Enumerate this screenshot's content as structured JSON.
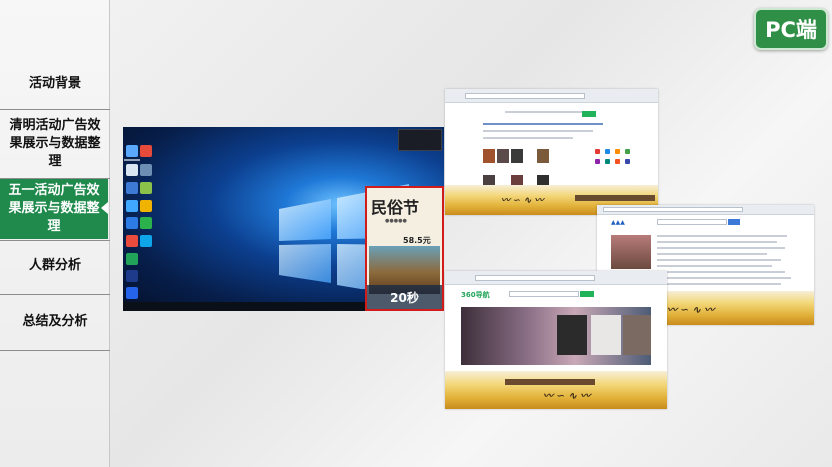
{
  "sidebar": {
    "items": [
      {
        "label": "活动背景",
        "active": false
      },
      {
        "label": "清明活动广告效果展示与数据整理",
        "active": false
      },
      {
        "label": "五一活动广告效果展示与数据整理",
        "active": true
      },
      {
        "label": "人群分析",
        "active": false
      },
      {
        "label": "总结及分析",
        "active": false
      }
    ]
  },
  "badge": {
    "label": "PC端"
  },
  "desktop_ad": {
    "title": "民俗节",
    "price": "58.5元",
    "timer": "20秒"
  },
  "browser_shots": {
    "sogou_logo": "360导航",
    "search_button": "搜索"
  },
  "colors": {
    "accent_green": "#1f8a4c",
    "badge_green": "#2f8f46",
    "ad_border": "#d21c1c"
  }
}
